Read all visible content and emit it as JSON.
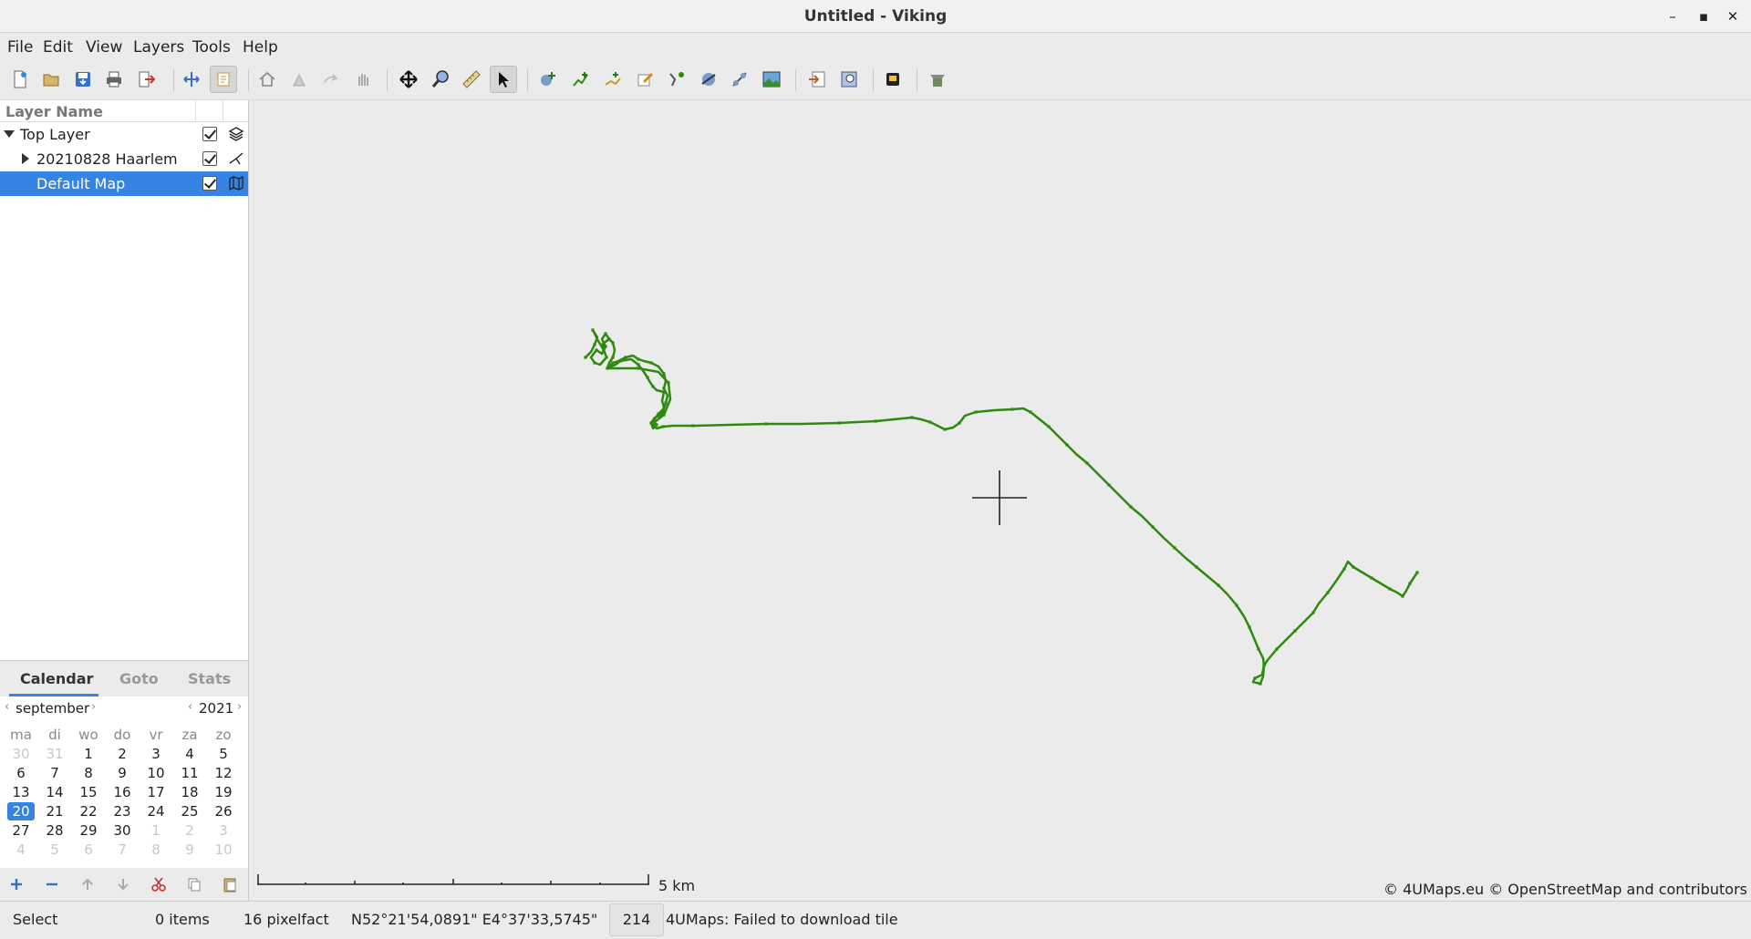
{
  "window": {
    "title": "Untitled - Viking",
    "minimize_glyph": "–",
    "maximize_glyph": "▪",
    "close_glyph": "✕"
  },
  "menu": [
    "File",
    "Edit",
    "View",
    "Layers",
    "Tools",
    "Help"
  ],
  "toolbar": {
    "buttons": [
      "new-file-icon",
      "open-folder-icon",
      "save-icon",
      "print-icon",
      "exit-icon",
      "pan-move-icon",
      "select-mode-icon",
      "home-icon",
      "flag-icon",
      "redo-icon",
      "hand-icon",
      "pan-tool-icon",
      "zoom-tool-icon",
      "ruler-icon",
      "select-tool-icon",
      "create-waypoint-icon",
      "create-track-icon",
      "route-icon",
      "edit-waypoint-icon",
      "edit-trackpoint-icon",
      "show-picture-icon",
      "download-map-icon",
      "georef-icon",
      "extract-icon",
      "zoom-region-icon",
      "gps-icon",
      "dem-icon"
    ],
    "active": [
      "select-mode-icon",
      "select-tool-icon"
    ]
  },
  "layers": {
    "header": "Layer Name",
    "items": [
      {
        "name": "Top Layer",
        "expanded": true,
        "selected": false,
        "visible": true,
        "icon": "aggregate-layers-icon"
      },
      {
        "name": "20210828 Haarlem",
        "expanded": false,
        "selected": false,
        "visible": true,
        "icon": "trw-layer-icon"
      },
      {
        "name": "Default Map",
        "expanded": null,
        "selected": true,
        "visible": true,
        "icon": "map-layer-icon"
      }
    ]
  },
  "sidetabs": {
    "tabs": [
      "Calendar",
      "Goto",
      "Stats"
    ],
    "active": "Calendar"
  },
  "calendar": {
    "month": "september",
    "year": "2021",
    "prev_glyph": "‹",
    "next_glyph": "›",
    "weekdays": [
      "ma",
      "di",
      "wo",
      "do",
      "vr",
      "za",
      "zo"
    ],
    "weeks": [
      [
        "30",
        "31",
        "1",
        "2",
        "3",
        "4",
        "5"
      ],
      [
        "6",
        "7",
        "8",
        "9",
        "10",
        "11",
        "12"
      ],
      [
        "13",
        "14",
        "15",
        "16",
        "17",
        "18",
        "19"
      ],
      [
        "20",
        "21",
        "22",
        "23",
        "24",
        "25",
        "26"
      ],
      [
        "27",
        "28",
        "29",
        "30",
        "1",
        "2",
        "3"
      ],
      [
        "4",
        "5",
        "6",
        "7",
        "8",
        "9",
        "10"
      ]
    ],
    "outside_days": [
      [
        0,
        0
      ],
      [
        0,
        1
      ],
      [
        4,
        4
      ],
      [
        4,
        5
      ],
      [
        4,
        6
      ],
      [
        5,
        0
      ],
      [
        5,
        1
      ],
      [
        5,
        2
      ],
      [
        5,
        3
      ],
      [
        5,
        4
      ],
      [
        5,
        5
      ],
      [
        5,
        6
      ]
    ],
    "selected_day": "20"
  },
  "layer_buttons": [
    "add-icon",
    "remove-icon",
    "move-up-icon",
    "move-down-icon",
    "cut-icon",
    "copy-icon",
    "paste-icon"
  ],
  "map": {
    "track_color": "#2d8a0e",
    "scale_label": "5 km",
    "attribution": "© 4UMaps.eu © OpenStreetMap and contributors"
  },
  "status": {
    "tool": "Select",
    "items": "0 items",
    "zoom": "16 pixelfact",
    "position": "N52°21'54,0891\" E4°37'33,5745\"",
    "count": "214",
    "message": "4UMaps: Failed to download tile"
  }
}
